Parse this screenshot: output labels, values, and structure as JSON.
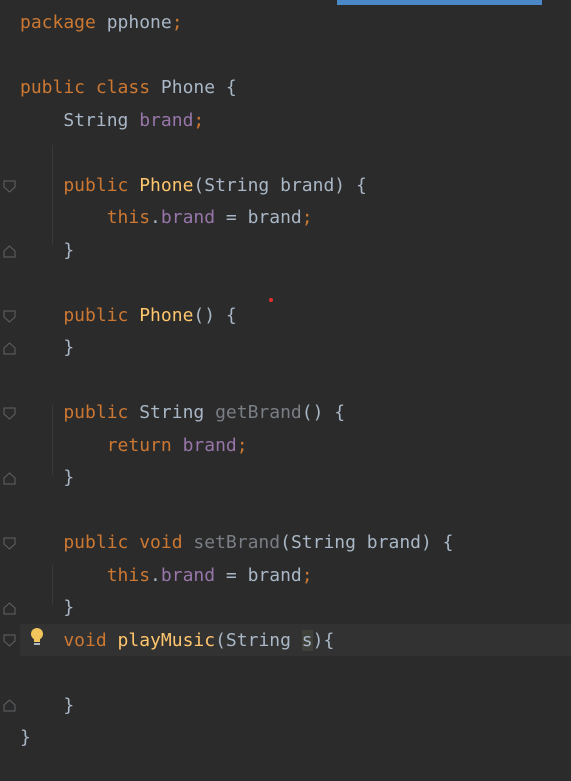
{
  "editor": {
    "lines": [
      [
        {
          "t": "package ",
          "c": "kw"
        },
        {
          "t": "pphone",
          "c": "plain"
        },
        {
          "t": ";",
          "c": "kw"
        }
      ],
      [],
      [
        {
          "t": "public ",
          "c": "kw"
        },
        {
          "t": "class ",
          "c": "kw"
        },
        {
          "t": "Phone {",
          "c": "plain"
        }
      ],
      [
        {
          "t": "    String ",
          "c": "plain"
        },
        {
          "t": "brand",
          "c": "fld"
        },
        {
          "t": ";",
          "c": "kw"
        }
      ],
      [],
      [
        {
          "t": "    public ",
          "c": "kw"
        },
        {
          "t": "Phone",
          "c": "meth"
        },
        {
          "t": "(String brand) {",
          "c": "plain"
        }
      ],
      [
        {
          "t": "        this",
          "c": "kw"
        },
        {
          "t": ".",
          "c": "plain"
        },
        {
          "t": "brand",
          "c": "fld"
        },
        {
          "t": " = brand",
          "c": "plain"
        },
        {
          "t": ";",
          "c": "kw"
        }
      ],
      [
        {
          "t": "    }",
          "c": "plain"
        }
      ],
      [],
      [
        {
          "t": "    public ",
          "c": "kw"
        },
        {
          "t": "Phone",
          "c": "meth"
        },
        {
          "t": "() {",
          "c": "plain"
        }
      ],
      [
        {
          "t": "    }",
          "c": "plain"
        }
      ],
      [],
      [
        {
          "t": "    public ",
          "c": "kw"
        },
        {
          "t": "String ",
          "c": "plain"
        },
        {
          "t": "getBrand",
          "c": "gray"
        },
        {
          "t": "() {",
          "c": "plain"
        }
      ],
      [
        {
          "t": "        return ",
          "c": "kw"
        },
        {
          "t": "brand",
          "c": "fld"
        },
        {
          "t": ";",
          "c": "kw"
        }
      ],
      [
        {
          "t": "    }",
          "c": "plain"
        }
      ],
      [],
      [
        {
          "t": "    public ",
          "c": "kw"
        },
        {
          "t": "void ",
          "c": "kw"
        },
        {
          "t": "setBrand",
          "c": "gray"
        },
        {
          "t": "(String brand) {",
          "c": "plain"
        }
      ],
      [
        {
          "t": "        this",
          "c": "kw"
        },
        {
          "t": ".",
          "c": "plain"
        },
        {
          "t": "brand",
          "c": "fld"
        },
        {
          "t": " = brand",
          "c": "plain"
        },
        {
          "t": ";",
          "c": "kw"
        }
      ],
      [
        {
          "t": "    }",
          "c": "plain"
        }
      ],
      [
        {
          "t": "    void ",
          "c": "kw"
        },
        {
          "t": "playMusic",
          "c": "meth"
        },
        {
          "t": "(String ",
          "c": "plain"
        },
        {
          "t": "s",
          "c": "plain hl"
        },
        {
          "t": "){",
          "c": "plain"
        }
      ],
      [],
      [
        {
          "t": "    }",
          "c": "plain"
        }
      ],
      [
        {
          "t": "}",
          "c": "plain"
        }
      ]
    ]
  },
  "colors": {
    "background": "#2b2b2b",
    "keyword": "#cc7832",
    "field": "#9876aa",
    "method_decl": "#ffc66d",
    "unused_method": "#7a7e85",
    "text": "#a9b7c6",
    "caret_line": "#323232",
    "scroll_indicator": "#4a88c7"
  },
  "icons": {
    "intention": "lightbulb-icon",
    "fold_start": "fold-open-icon",
    "fold_end": "fold-close-icon"
  }
}
